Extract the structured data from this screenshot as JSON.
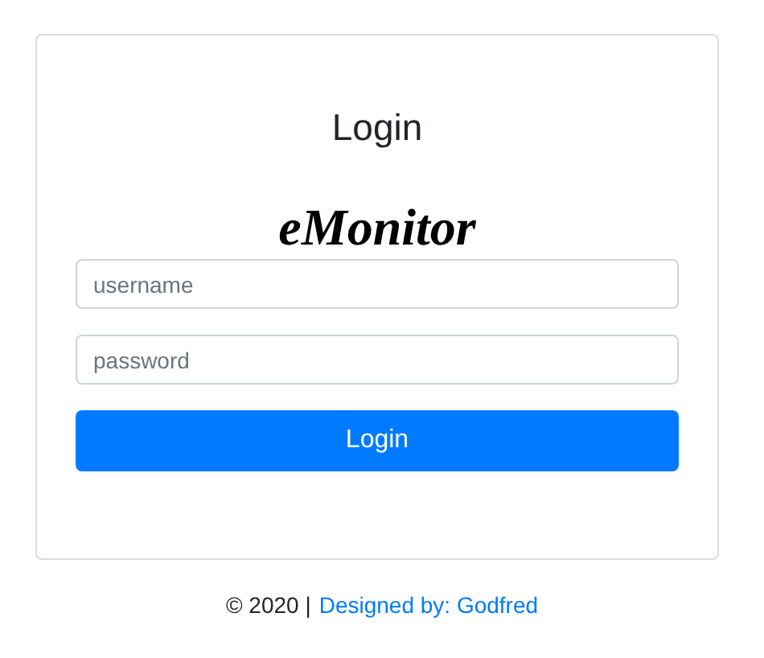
{
  "card": {
    "title": "Login",
    "logo": "eMonitor",
    "fields": [
      {
        "placeholder": "username"
      },
      {
        "placeholder": "password"
      }
    ],
    "button": "Login"
  },
  "footer": {
    "text": "© 2020 |",
    "link": "Designed by: Godfred"
  }
}
